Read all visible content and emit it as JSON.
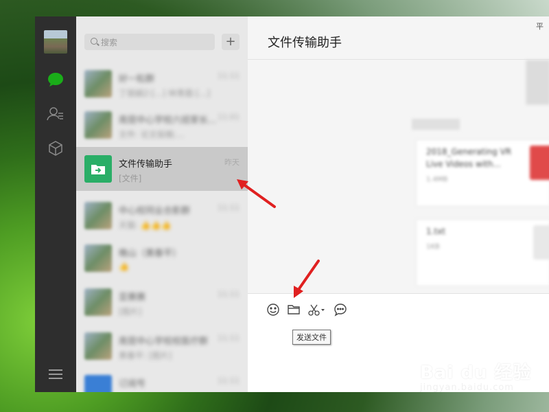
{
  "search": {
    "placeholder": "搜索"
  },
  "list": {
    "add_label": "+",
    "rows": [
      {
        "name": "好一粒群",
        "preview": "丁丽娟2:[...] 林青霞:[...]",
        "time": "11:11",
        "blurred": true
      },
      {
        "name": "南昆中心学校六班家长...",
        "preview": "文件:   论文投稿:...",
        "time": "11:01",
        "blurred": true
      },
      {
        "name": "文件传输助手",
        "preview": "[文件]",
        "time": "昨天",
        "selected": true
      },
      {
        "name": "中心校同业合影群",
        "preview": "天猫: 👍👍👍",
        "time": "11:11",
        "blurred": true
      },
      {
        "name": "晚山（黄春平）",
        "preview": "👍",
        "time": "",
        "blurred": true
      },
      {
        "name": "亚赛赛",
        "preview": "[图片]",
        "time": "11:11",
        "blurred": true
      },
      {
        "name": "南昆中心学校校医疗群",
        "preview": "黄春平: [图片]",
        "time": "11:11",
        "blurred": true
      },
      {
        "name": "订阅号",
        "preview": "",
        "time": "11:11",
        "blurred": true
      }
    ]
  },
  "chat": {
    "title": "文件传输助手",
    "window_control": "平",
    "messages": [
      {
        "card_title": "2018_Generating VR Live Videos with...",
        "card_meta": "1.4MB"
      },
      {
        "card_title": "1.txt",
        "card_meta": "1KB"
      }
    ]
  },
  "toolbar": {
    "tooltip": "发送文件",
    "icons": [
      "emoji-icon",
      "folder-icon",
      "scissors-icon",
      "chat-bubble-icon"
    ]
  },
  "watermark": {
    "line1": "Bai du 经验",
    "line2": "jingyan.baidu.com"
  },
  "colors": {
    "accent_green": "#2aae67",
    "arrow_red": "#e02020",
    "nav_bg": "#2e2e2e"
  }
}
